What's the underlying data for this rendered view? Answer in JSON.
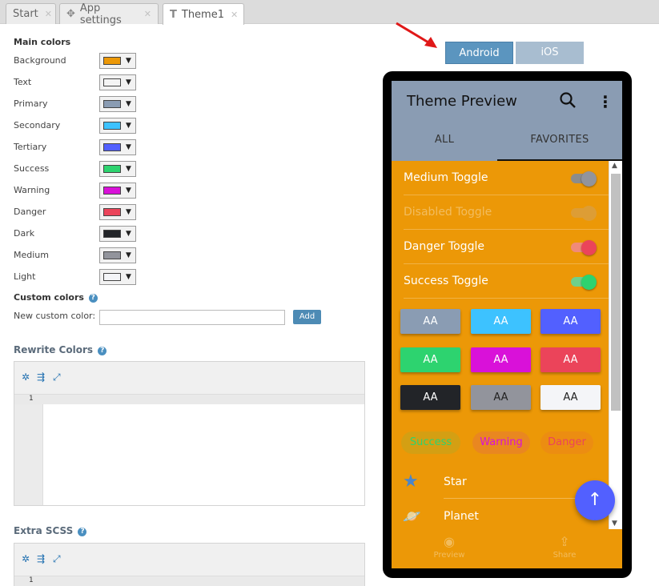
{
  "tabs": [
    {
      "label": "Start",
      "active": false
    },
    {
      "label": "App settings",
      "active": false
    },
    {
      "label": "Theme1",
      "active": true
    }
  ],
  "main_colors": {
    "title": "Main colors",
    "items": [
      {
        "label": "Background",
        "color": "#ec9807"
      },
      {
        "label": "Text",
        "color": "#f4f4f4"
      },
      {
        "label": "Primary",
        "color": "#8a9cb3"
      },
      {
        "label": "Secondary",
        "color": "#3dc2ff"
      },
      {
        "label": "Tertiary",
        "color": "#5260ff"
      },
      {
        "label": "Success",
        "color": "#2dd36f"
      },
      {
        "label": "Warning",
        "color": "#d911d9"
      },
      {
        "label": "Danger",
        "color": "#eb445a"
      },
      {
        "label": "Dark",
        "color": "#222428"
      },
      {
        "label": "Medium",
        "color": "#92949c"
      },
      {
        "label": "Light",
        "color": "#f4f5f8"
      }
    ]
  },
  "custom_colors": {
    "title": "Custom colors",
    "new_label": "New custom color:",
    "input_value": "",
    "add_label": "Add"
  },
  "rewrite_colors": {
    "title": "Rewrite Colors",
    "line_number": "1"
  },
  "extra_scss": {
    "title": "Extra SCSS",
    "line_number": "1"
  },
  "platform": {
    "android_label": "Android",
    "ios_label": "iOS",
    "selected": "Android"
  },
  "preview": {
    "title": "Theme Preview",
    "tab_all": "ALL",
    "tab_favorites": "FAVORITES",
    "active_tab": "FAVORITES",
    "toggles": [
      {
        "label": "Medium Toggle",
        "on": true,
        "disabled": false
      },
      {
        "label": "Disabled Toggle",
        "on": true,
        "disabled": true
      },
      {
        "label": "Danger Toggle",
        "on": true,
        "disabled": false
      },
      {
        "label": "Success Toggle",
        "on": true,
        "disabled": false
      }
    ],
    "aa_buttons": [
      {
        "label": "AA",
        "color": "#8a9cb3",
        "text": "#fff"
      },
      {
        "label": "AA",
        "color": "#3dc2ff",
        "text": "#fff"
      },
      {
        "label": "AA",
        "color": "#5260ff",
        "text": "#fff"
      },
      {
        "label": "AA",
        "color": "#2dd36f",
        "text": "#fff"
      },
      {
        "label": "AA",
        "color": "#d911d9",
        "text": "#fff"
      },
      {
        "label": "AA",
        "color": "#eb445a",
        "text": "#fff"
      },
      {
        "label": "AA",
        "color": "#222428",
        "text": "#fff"
      },
      {
        "label": "AA",
        "color": "#92949c",
        "text": "#222"
      },
      {
        "label": "AA",
        "color": "#f4f5f8",
        "text": "#222"
      }
    ],
    "chips": [
      {
        "label": "Success",
        "color": "#2dd36f"
      },
      {
        "label": "Warning",
        "color": "#d911d9"
      },
      {
        "label": "Danger",
        "color": "#eb445a"
      }
    ],
    "list_items": [
      {
        "label": "Star",
        "icon": "star-icon"
      },
      {
        "label": "Planet",
        "icon": "planet-icon"
      }
    ],
    "bottom_nav": [
      {
        "label": "Preview",
        "icon": "palette-icon"
      },
      {
        "label": "Share",
        "icon": "share-icon"
      }
    ]
  },
  "colors": {
    "accent_blue": "#4d8bb5",
    "arrow_red": "#e01818"
  }
}
